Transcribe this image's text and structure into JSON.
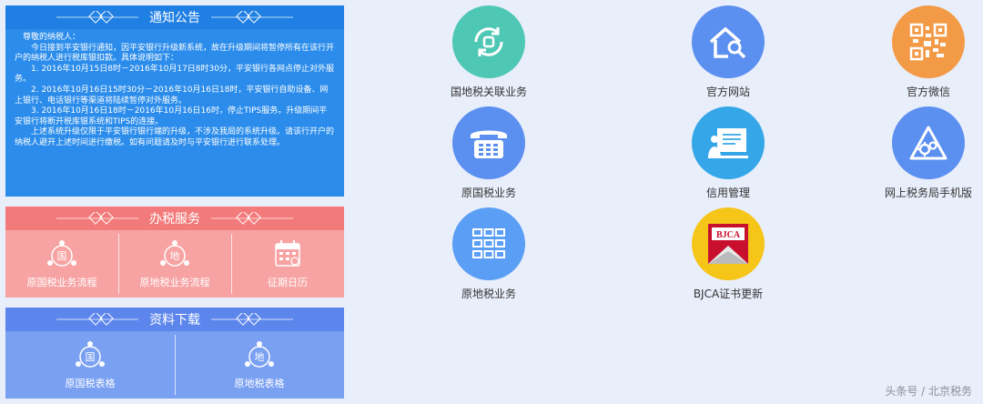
{
  "notice": {
    "title": "通知公告",
    "greeting": "尊敬的纳税人：",
    "paragraphs": [
      "今日接到平安银行通知，因平安银行升级新系统，故在升级期间将暂停所有在该行开户的纳税人进行税库银扣款。具体说明如下：",
      "1. 2016年10月15日8时－2016年10月17日8时30分，平安银行各网点停止对外服务。",
      "2. 2016年10月16日15时30分－2016年10月16日18时，平安银行自助设备、网上银行、电话银行等渠道将陆续暂停对外服务。",
      "3. 2016年10月16日18时－2016年10月16日16时，停止TIPS服务。升级期间平安银行将断开税库银系统和TIPS的连接。",
      "上述系统升级仅限于平安银行银行端的升级，不涉及我局的系统升级。请该行开户的纳税人避开上述时间进行缴税。如有问题请及时与平安银行进行联系处理。"
    ]
  },
  "tax_service": {
    "title": "办税服务",
    "tiles": [
      {
        "label": "原国税业务流程",
        "glyph": "国",
        "icon": "national-tax-process-icon"
      },
      {
        "label": "原地税业务流程",
        "glyph": "地",
        "icon": "local-tax-process-icon"
      },
      {
        "label": "征期日历",
        "glyph": "",
        "icon": "calendar-icon"
      }
    ]
  },
  "download": {
    "title": "资料下载",
    "tiles": [
      {
        "label": "原国税表格",
        "glyph": "国",
        "icon": "national-tax-forms-icon"
      },
      {
        "label": "原地税表格",
        "glyph": "地",
        "icon": "local-tax-forms-icon"
      }
    ]
  },
  "apps": [
    {
      "label": "国地税关联业务",
      "icon": "linked-business-icon",
      "color": "#4fc7b5"
    },
    {
      "label": "官方网站",
      "icon": "house-search-icon",
      "color": "#5b8ff0"
    },
    {
      "label": "官方微信",
      "icon": "qrcode-icon",
      "color": "#f39a47"
    },
    {
      "label": "原国税业务",
      "icon": "telephone-icon",
      "color": "#5b8ff0"
    },
    {
      "label": "信用管理",
      "icon": "credit-board-icon",
      "color": "#35a7e8"
    },
    {
      "label": "网上税务局手机版",
      "icon": "mobile-gears-icon",
      "color": "#5b8ff0"
    },
    {
      "label": "原地税业务",
      "icon": "grid-building-icon",
      "color": "#5b9ef5"
    },
    {
      "label": "BJCA证书更新",
      "icon": "bjca-logo-icon",
      "color": "#f5c518",
      "logo_text": "BJCA"
    }
  ],
  "watermark": "头条号 / 北京税务",
  "colors": {
    "notice_bg": "#2b8ceb",
    "tax_bg": "#f7a3a3",
    "download_bg": "#7aa0f2"
  }
}
